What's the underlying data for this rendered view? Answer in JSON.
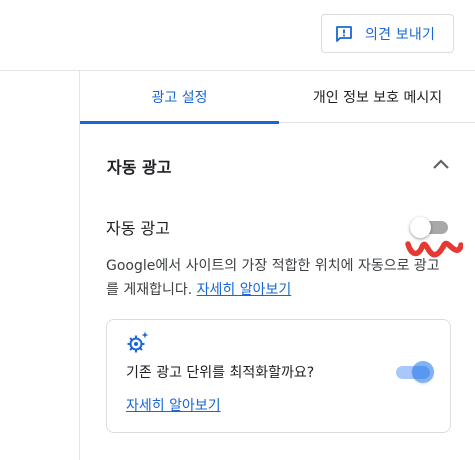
{
  "header": {
    "feedback_label": "의견 보내기",
    "feedback_icon": "feedback-icon"
  },
  "tabs": [
    {
      "label": "광고 설정",
      "active": true
    },
    {
      "label": "개인 정보 보호 메시지",
      "active": false
    }
  ],
  "section": {
    "title": "자동 광고",
    "expanded": true,
    "chevron_icon": "chevron-up-icon"
  },
  "auto_ads": {
    "label": "자동 광고",
    "enabled": false,
    "description": "Google에서 사이트의 가장 적합한 위치에 자동으로 광고를 게재합니다.",
    "learn_more": "자세히 알아보기"
  },
  "optimize_card": {
    "icon": "sparkle-gear-icon",
    "question": "기존 광고 단위를 최적화할까요?",
    "enabled": true,
    "learn_more": "자세히 알아보기"
  },
  "colors": {
    "accent": "#1967d2",
    "annotation": "#e53935"
  }
}
